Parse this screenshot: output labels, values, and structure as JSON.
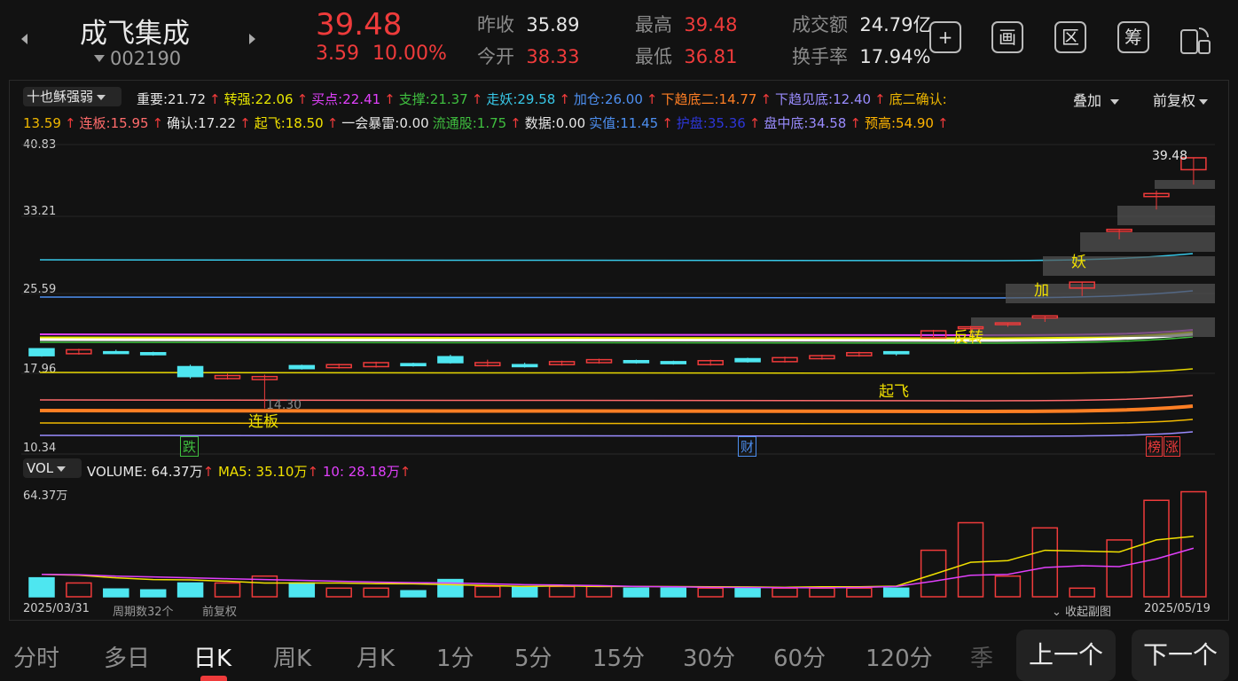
{
  "header": {
    "stock_name": "成飞集成",
    "stock_code": "002190",
    "price": "39.48",
    "change": "3.59",
    "change_pct": "10.00%",
    "prev_close_label": "昨收",
    "prev_close": "35.89",
    "open_label": "今开",
    "open": "38.33",
    "high_label": "最高",
    "high": "39.48",
    "low_label": "最低",
    "low": "36.81",
    "turnover_amt_label": "成交额",
    "turnover_amt": "24.79亿",
    "turnover_rate_label": "换手率",
    "turnover_rate": "17.94%",
    "toolbar": {
      "add": "+",
      "draw": "画",
      "range": "区",
      "chips": "筹"
    }
  },
  "indicator": {
    "selector": "十也稣强弱",
    "overlay_label": "叠加",
    "adjust_label": "前复权",
    "items": [
      {
        "name": "重要",
        "value": "21.72",
        "color": "#e6e6e6"
      },
      {
        "name": "转强",
        "value": "22.06",
        "color": "#e6e600"
      },
      {
        "name": "买点",
        "value": "22.41",
        "color": "#e040fb"
      },
      {
        "name": "支撑",
        "value": "21.37",
        "color": "#3fbf3f"
      },
      {
        "name": "走妖",
        "value": "29.58",
        "color": "#38c8e8"
      },
      {
        "name": "加仓",
        "value": "26.00",
        "color": "#4d8ff0"
      },
      {
        "name": "下趋底二",
        "value": "14.77",
        "color": "#ff7f24"
      },
      {
        "name": "下趋见底",
        "value": "12.40",
        "color": "#9a8cff"
      },
      {
        "name": "底二确认",
        "value": "13.59",
        "color": "#f0b800"
      },
      {
        "name": "连板",
        "value": "15.95",
        "color": "#ff6b6b"
      },
      {
        "name": "确认",
        "value": "17.22",
        "color": "#e6e6e6"
      },
      {
        "name": "起飞",
        "value": "18.50",
        "color": "#f0e000"
      },
      {
        "name": "一会暴雷",
        "value": "0.00",
        "color": "#e6e6e6"
      },
      {
        "name": "流通股",
        "value": "1.75",
        "color": "#3fbf3f"
      },
      {
        "name": "数据",
        "value": "0.00",
        "color": "#e6e6e6"
      },
      {
        "name": "实值",
        "value": "11.45",
        "color": "#4d8ff0"
      },
      {
        "name": "护盘",
        "value": "35.36",
        "color": "#2d36d8"
      },
      {
        "name": "盘中底",
        "value": "34.58",
        "color": "#9a8cff"
      },
      {
        "name": "预高",
        "value": "54.90",
        "color": "#ffb400"
      }
    ]
  },
  "price_axis": [
    "40.83",
    "33.21",
    "25.59",
    "17.96",
    "10.34"
  ],
  "annotations": {
    "last_price": "39.48",
    "low_marker": "14.30",
    "yao": "妖",
    "jia": "加",
    "fanzhuan": "反转",
    "qifei": "起飞",
    "lianban": "连板",
    "die": "跌",
    "cai": "财",
    "bang": "榜",
    "zhang": "涨"
  },
  "volume": {
    "selector": "VOL",
    "volume_label": "VOLUME",
    "volume_value": "64.37万",
    "ma5_label": "MA5",
    "ma5_value": "35.10万",
    "ma10_label": "10",
    "ma10_value": "28.18万",
    "axis_top": "64.37万"
  },
  "footer": {
    "start_date": "2025/03/31",
    "period_count": "周期数32个",
    "adjust": "前复权",
    "collapse": "收起副图",
    "end_date": "2025/05/19"
  },
  "chart_data": {
    "type": "candlestick",
    "y_range": [
      10.34,
      40.83
    ],
    "candles": [
      {
        "o": 20.3,
        "c": 19.6,
        "h": 20.3,
        "l": 19.5
      },
      {
        "o": 19.8,
        "c": 20.2,
        "h": 20.3,
        "l": 19.7
      },
      {
        "o": 20.0,
        "c": 19.9,
        "h": 20.2,
        "l": 19.8
      },
      {
        "o": 19.9,
        "c": 19.7,
        "h": 20.0,
        "l": 19.6
      },
      {
        "o": 18.5,
        "c": 17.5,
        "h": 18.7,
        "l": 17.3
      },
      {
        "o": 17.3,
        "c": 17.6,
        "h": 17.8,
        "l": 17.2
      },
      {
        "o": 17.2,
        "c": 17.5,
        "h": 17.7,
        "l": 14.3
      },
      {
        "o": 18.6,
        "c": 18.3,
        "h": 18.7,
        "l": 18.2
      },
      {
        "o": 18.4,
        "c": 18.7,
        "h": 18.8,
        "l": 18.3
      },
      {
        "o": 18.5,
        "c": 18.9,
        "h": 19.0,
        "l": 18.4
      },
      {
        "o": 18.8,
        "c": 18.6,
        "h": 18.9,
        "l": 18.5
      },
      {
        "o": 19.5,
        "c": 18.9,
        "h": 19.7,
        "l": 18.8
      },
      {
        "o": 18.6,
        "c": 18.9,
        "h": 19.2,
        "l": 18.5
      },
      {
        "o": 18.7,
        "c": 18.5,
        "h": 18.9,
        "l": 18.4
      },
      {
        "o": 18.7,
        "c": 19.0,
        "h": 19.1,
        "l": 18.6
      },
      {
        "o": 18.9,
        "c": 19.2,
        "h": 19.3,
        "l": 18.8
      },
      {
        "o": 19.1,
        "c": 18.9,
        "h": 19.2,
        "l": 18.8
      },
      {
        "o": 19.0,
        "c": 18.8,
        "h": 19.1,
        "l": 18.7
      },
      {
        "o": 18.7,
        "c": 19.1,
        "h": 19.2,
        "l": 18.6
      },
      {
        "o": 19.3,
        "c": 19.0,
        "h": 19.4,
        "l": 18.9
      },
      {
        "o": 19.0,
        "c": 19.4,
        "h": 19.5,
        "l": 18.9
      },
      {
        "o": 19.3,
        "c": 19.6,
        "h": 19.7,
        "l": 19.2
      },
      {
        "o": 19.6,
        "c": 19.9,
        "h": 20.0,
        "l": 19.5
      },
      {
        "o": 20.0,
        "c": 19.8,
        "h": 20.0,
        "l": 19.6
      },
      {
        "o": 21.4,
        "c": 22.1,
        "h": 22.2,
        "l": 21.3
      },
      {
        "o": 22.5,
        "c": 22.5,
        "h": 22.6,
        "l": 21.6
      },
      {
        "o": 22.8,
        "c": 22.9,
        "h": 22.9,
        "l": 22.5
      },
      {
        "o": 23.4,
        "c": 23.6,
        "h": 23.6,
        "l": 23.0
      },
      {
        "o": 26.4,
        "c": 27.0,
        "h": 27.0,
        "l": 25.6
      },
      {
        "o": 32.1,
        "c": 32.3,
        "h": 32.3,
        "l": 31.3
      },
      {
        "o": 35.6,
        "c": 35.9,
        "h": 36.2,
        "l": 34.3
      },
      {
        "o": 38.3,
        "c": 39.5,
        "h": 39.5,
        "l": 36.8
      }
    ],
    "volumes": [
      11,
      8,
      4.5,
      4,
      8,
      8,
      12,
      8,
      5,
      5,
      3.5,
      10,
      6,
      6,
      6,
      6,
      5,
      5,
      5,
      5,
      5,
      5,
      5,
      5,
      27,
      43,
      12,
      40,
      5,
      33,
      56,
      61
    ],
    "ma5": [
      13,
      12.5,
      11,
      10,
      9.8,
      9,
      8,
      8,
      8,
      7.6,
      7.5,
      7,
      6.5,
      6,
      6.3,
      6,
      6,
      5.9,
      5.8,
      5.7,
      5.5,
      5.8,
      5.8,
      6.2,
      13,
      20,
      21,
      27,
      26.5,
      26,
      33,
      35.1
    ],
    "ma10": [
      13,
      12.8,
      12,
      11.5,
      11,
      10.5,
      10,
      9.5,
      9,
      8.5,
      8.2,
      8,
      7.5,
      7,
      6.8,
      6.5,
      6,
      5.8,
      5.5,
      5.4,
      5.3,
      5.2,
      5.4,
      6,
      9,
      12.5,
      13,
      17,
      18,
      17.5,
      22,
      28.18
    ]
  }
}
